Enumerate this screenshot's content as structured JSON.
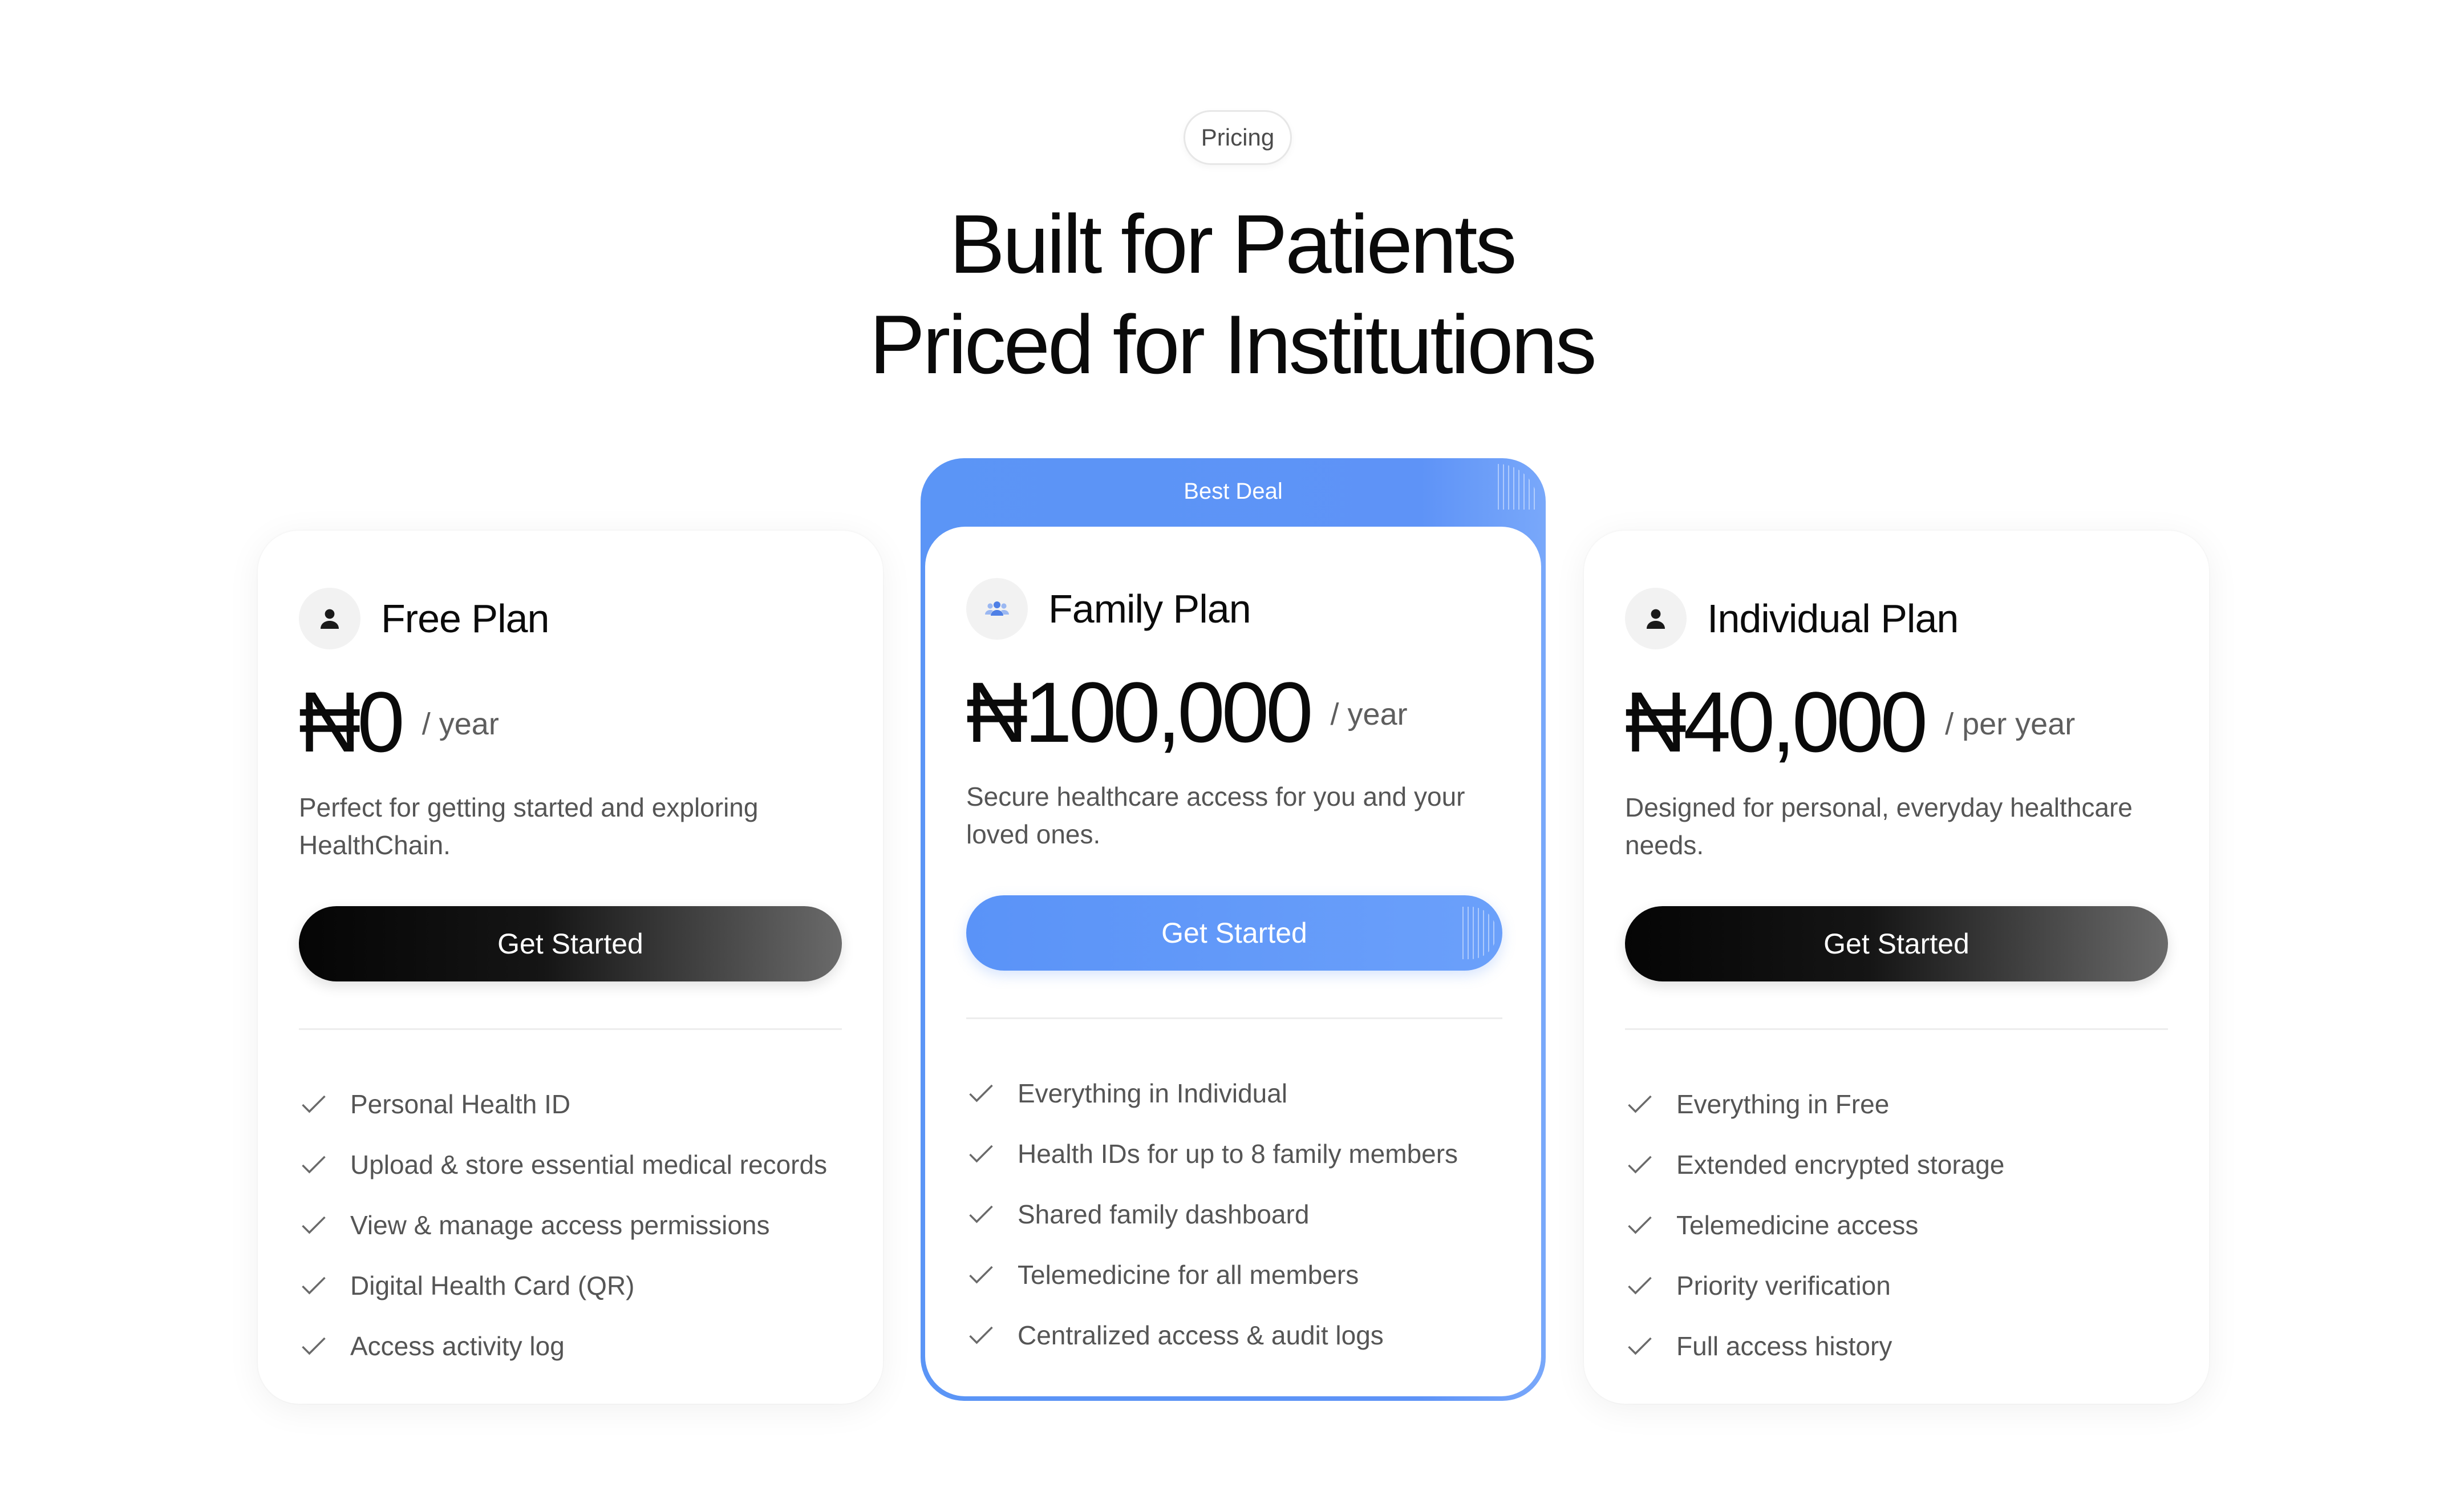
{
  "badge": "Pricing",
  "headline": {
    "line1": "Built for Patients",
    "line2": "Priced for Institutions"
  },
  "colors": {
    "accent": "#5b95f6",
    "dark_button": "#0a0a0a",
    "text_muted": "#555555"
  },
  "plans": {
    "free": {
      "icon": "user-icon",
      "name": "Free Plan",
      "price": "₦0",
      "period": "/ year",
      "description": "Perfect for getting started and exploring HealthChain.",
      "cta": "Get Started",
      "features": [
        "Personal Health ID",
        "Upload & store essential medical records",
        "View & manage access permissions",
        "Digital Health Card (QR)",
        "Access activity log"
      ]
    },
    "family": {
      "ribbon": "Best Deal",
      "icon": "family-icon",
      "name": "Family Plan",
      "price": "₦100,000",
      "period": "/ year",
      "description": "Secure healthcare access for you and your loved ones.",
      "cta": "Get Started",
      "features": [
        "Everything in Individual",
        "Health IDs for up to 8 family members",
        "Shared family dashboard",
        "Telemedicine for all members",
        "Centralized access & audit logs"
      ]
    },
    "individual": {
      "icon": "user-icon",
      "name": "Individual Plan",
      "price": "₦40,000",
      "period": "/ per year",
      "description": "Designed for personal, everyday healthcare needs.",
      "cta": "Get Started",
      "features": [
        "Everything in Free",
        "Extended encrypted storage",
        "Telemedicine access",
        "Priority verification",
        "Full access history"
      ]
    }
  }
}
